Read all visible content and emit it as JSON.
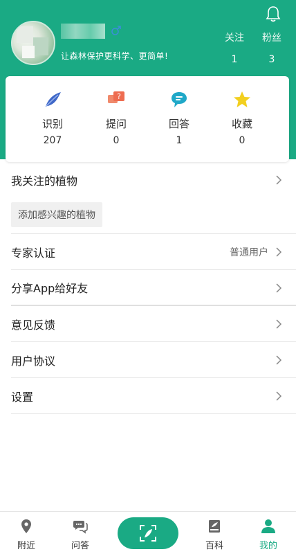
{
  "colors": {
    "brand": "#1aaa84",
    "divider": "#e6e6e6"
  },
  "profile": {
    "slogan": "让森林保护更科学、更简单!",
    "gender_icon": "male-icon",
    "follow_label": "关注",
    "follow_count": "1",
    "fans_label": "粉丝",
    "fans_count": "3"
  },
  "stats": [
    {
      "label": "识别",
      "value": "207",
      "icon": "leaf-icon"
    },
    {
      "label": "提问",
      "value": "0",
      "icon": "question-icon"
    },
    {
      "label": "回答",
      "value": "1",
      "icon": "chat-icon"
    },
    {
      "label": "收藏",
      "value": "0",
      "icon": "star-icon"
    }
  ],
  "menu": {
    "followed_plants": "我关注的植物",
    "add_plant": "添加感兴趣的植物",
    "expert_cert": "专家认证",
    "expert_status": "普通用户",
    "share_app": "分享App给好友",
    "feedback": "意见反馈",
    "agreement": "用户协议",
    "settings": "设置"
  },
  "tabs": [
    {
      "label": "附近",
      "icon": "location-icon"
    },
    {
      "label": "问答",
      "icon": "chat-bubbles-icon"
    },
    {
      "label": "",
      "icon": "scan-icon"
    },
    {
      "label": "百科",
      "icon": "book-icon"
    },
    {
      "label": "我的",
      "icon": "person-icon"
    }
  ]
}
